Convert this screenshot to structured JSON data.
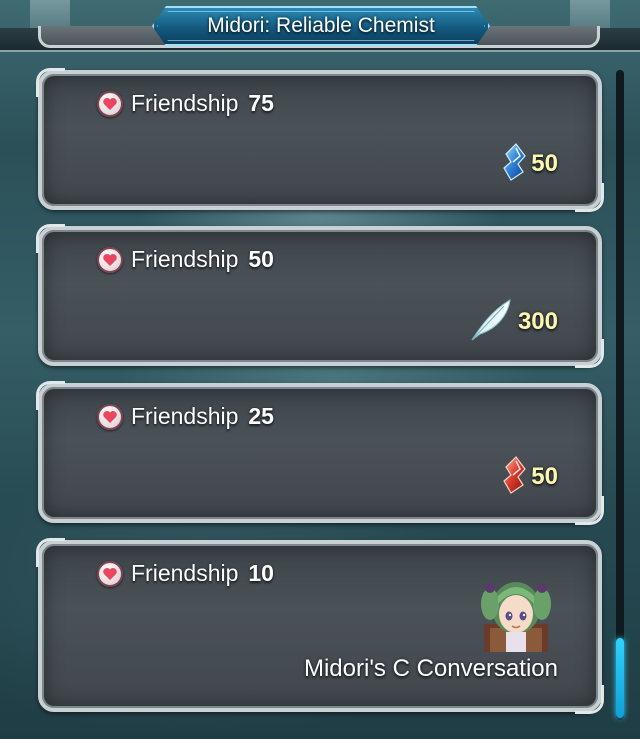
{
  "title": "Midori: Reliable Chemist",
  "rewards": [
    {
      "friendship_label": "Friendship",
      "friendship_value": "75",
      "reward_icon": "blue-orb-icon",
      "reward_amount": "50"
    },
    {
      "friendship_label": "Friendship",
      "friendship_value": "50",
      "reward_icon": "feather-icon",
      "reward_amount": "300"
    },
    {
      "friendship_label": "Friendship",
      "friendship_value": "25",
      "reward_icon": "red-orb-icon",
      "reward_amount": "50"
    },
    {
      "friendship_label": "Friendship",
      "friendship_value": "10",
      "reward_icon": "midori-portrait",
      "reward_text": "Midori's C Conversation"
    }
  ],
  "colors": {
    "title_banner": "#14597f",
    "reward_amount": "#fff7b0",
    "scroll_thumb": "#2fd2ff"
  }
}
